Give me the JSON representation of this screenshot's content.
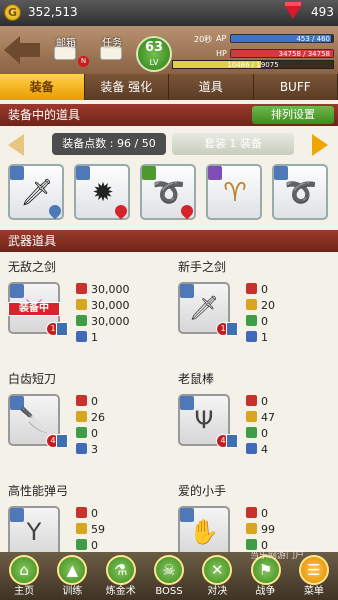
{
  "top_bar": {
    "coin_symbol": "G",
    "gold": "352,513",
    "gems": "493"
  },
  "header": {
    "mail_label": "邮箱",
    "task_label": "任务",
    "notif_badge": "N",
    "level": "63",
    "level_label": "LV",
    "seconds_label": "20秒",
    "ap_label": "AP",
    "ap_text": "453 / 460",
    "ap_fraction": 0.985,
    "hp_label": "HP",
    "hp_text": "34758 / 34758",
    "hp_fraction": 1.0,
    "exp_text": "10486 / 19075",
    "exp_fraction": 0.55
  },
  "tabs": [
    "装备",
    "装备 强化",
    "道具",
    "BUFF"
  ],
  "equipped_section": {
    "title": "装备中的道具",
    "sort_label": "排列设置",
    "points_label": "装备点数 : 96 / 50",
    "gear_set_label": "套装 1 装备"
  },
  "equipped_slots": [
    {
      "icon": "rainbow-sword-icon",
      "glyph": "🗡"
    },
    {
      "icon": "spiky-beast-icon",
      "glyph": "✹"
    },
    {
      "icon": "golden-coil-icon",
      "glyph": "➰"
    },
    {
      "icon": "horns-icon",
      "glyph": "♈"
    },
    {
      "icon": "dark-tail-icon",
      "glyph": "➰"
    }
  ],
  "weapons_section": {
    "title": "武器道具"
  },
  "weapons": [
    {
      "name": "无敌之剑",
      "equipped_label": "装备中",
      "level_badge": "1",
      "icon": "rainbow-sword-icon",
      "glyph": "⚔",
      "stats": [
        "30,000",
        "30,000",
        "30,000",
        "1"
      ]
    },
    {
      "name": "新手之剑",
      "equipped_label": "",
      "level_badge": "1",
      "icon": "katana-icon",
      "glyph": "🗡",
      "stats": [
        "0",
        "20",
        "0",
        "1"
      ]
    },
    {
      "name": "白齿短刀",
      "equipped_label": "",
      "level_badge": "4",
      "icon": "serrated-dagger-icon",
      "glyph": "🔪",
      "stats": [
        "0",
        "26",
        "0",
        "3"
      ]
    },
    {
      "name": "老鼠棒",
      "equipped_label": "",
      "level_badge": "4",
      "icon": "fork-staff-icon",
      "glyph": "Ψ",
      "stats": [
        "0",
        "47",
        "0",
        "4"
      ]
    },
    {
      "name": "高性能弹弓",
      "equipped_label": "",
      "level_badge": "",
      "icon": "slingshot-icon",
      "glyph": "Y",
      "stats": [
        "0",
        "59",
        "0",
        ""
      ]
    },
    {
      "name": "爱的小手",
      "equipped_label": "",
      "level_badge": "",
      "icon": "glove-hand-icon",
      "glyph": "✋",
      "stats": [
        "0",
        "99",
        "0",
        ""
      ]
    }
  ],
  "bottom_nav": [
    {
      "label": "主页",
      "glyph": "⌂",
      "icon": "home-icon"
    },
    {
      "label": "训练",
      "glyph": "▲",
      "icon": "training-icon"
    },
    {
      "label": "炼金术",
      "glyph": "⚗",
      "icon": "alchemy-icon"
    },
    {
      "label": "BOSS",
      "glyph": "☠",
      "icon": "boss-icon"
    },
    {
      "label": "对决",
      "glyph": "✕",
      "icon": "duel-icon"
    },
    {
      "label": "战争",
      "glyph": "⚑",
      "icon": "war-icon"
    },
    {
      "label": "菜单",
      "glyph": "☰",
      "icon": "menu-icon"
    }
  ],
  "watermark": "当乐网游门户"
}
